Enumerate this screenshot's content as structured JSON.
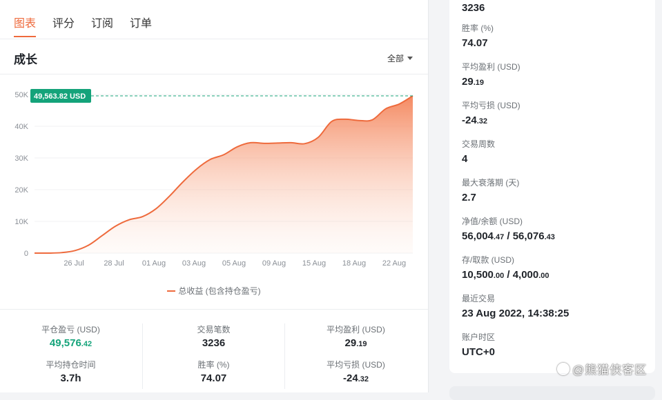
{
  "tabs": [
    {
      "label": "图表",
      "active": true
    },
    {
      "label": "评分",
      "active": false
    },
    {
      "label": "订阅",
      "active": false
    },
    {
      "label": "订单",
      "active": false
    }
  ],
  "section": {
    "title": "成长",
    "filter_label": "全部"
  },
  "chart_data": {
    "type": "area",
    "title": "",
    "xlabel": "",
    "ylabel": "",
    "legend_position": "bottom-center",
    "legend": [
      "总收益 (包含持仓盈亏)"
    ],
    "y_ticks": [
      "0",
      "10K",
      "20K",
      "30K",
      "40K",
      "50K"
    ],
    "ylim": [
      0,
      50000
    ],
    "x_ticks": [
      "26 Jul",
      "28 Jul",
      "01 Aug",
      "03 Aug",
      "05 Aug",
      "09 Aug",
      "15 Aug",
      "18 Aug",
      "22 Aug"
    ],
    "current_value_label": "49,563.82 USD",
    "current_value": 49563.82,
    "series": [
      {
        "name": "总收益 (包含持仓盈亏)",
        "color": "#ee6a3c",
        "x": [
          0,
          1,
          2,
          3,
          4,
          5,
          6,
          7,
          8,
          9,
          10,
          11,
          12,
          13,
          14,
          15,
          16,
          17,
          18,
          19,
          20,
          21,
          22,
          23,
          24,
          25,
          26,
          27,
          28
        ],
        "values": [
          0,
          0,
          150,
          800,
          2500,
          5500,
          8500,
          10500,
          11500,
          14000,
          18000,
          22500,
          26500,
          29500,
          31000,
          33500,
          34800,
          34600,
          34700,
          34800,
          34500,
          36500,
          41500,
          42200,
          41800,
          42000,
          45500,
          47000,
          49563.82
        ]
      }
    ]
  },
  "stats": {
    "closed_pnl": {
      "label": "平仓盈亏 (USD)",
      "int": "49,576",
      "dec": ".42"
    },
    "trade_count": {
      "label": "交易笔数",
      "value": "3236"
    },
    "avg_profit": {
      "label": "平均盈利 (USD)",
      "int": "29",
      "dec": ".19"
    },
    "avg_hold": {
      "label": "平均持仓时间",
      "value": "3.7h"
    },
    "win_rate": {
      "label": "胜率 (%)",
      "value": "74.07"
    },
    "avg_loss": {
      "label": "平均亏损 (USD)",
      "int": "-24",
      "dec": ".32"
    }
  },
  "side": {
    "trades_value": "3236",
    "win_rate": {
      "label": "胜率 (%)",
      "value": "74.07"
    },
    "avg_profit": {
      "label": "平均盈利 (USD)",
      "int": "29",
      "dec": ".19"
    },
    "avg_loss": {
      "label": "平均亏损 (USD)",
      "int": "-24",
      "dec": ".32"
    },
    "weeks": {
      "label": "交易周数",
      "value": "4"
    },
    "max_drawdown": {
      "label": "最大衰落期 (天)",
      "value": "2.7"
    },
    "equity_balance": {
      "label": "净值/余额 (USD)",
      "eq_int": "56,004",
      "eq_dec": ".47",
      "sep": " / ",
      "bal_int": "56,076",
      "bal_dec": ".43"
    },
    "deposit_withdraw": {
      "label": "存/取款 (USD)",
      "dep_int": "10,500",
      "dep_dec": ".00",
      "sep": " / ",
      "wd_int": "4,000",
      "wd_dec": ".00"
    },
    "last_trade": {
      "label": "最近交易",
      "value": "23 Aug 2022, 14:38:25"
    },
    "timezone": {
      "label": "账户时区",
      "value": "UTC+0"
    }
  },
  "watermark": {
    "text": "@熊猫侠客区"
  }
}
